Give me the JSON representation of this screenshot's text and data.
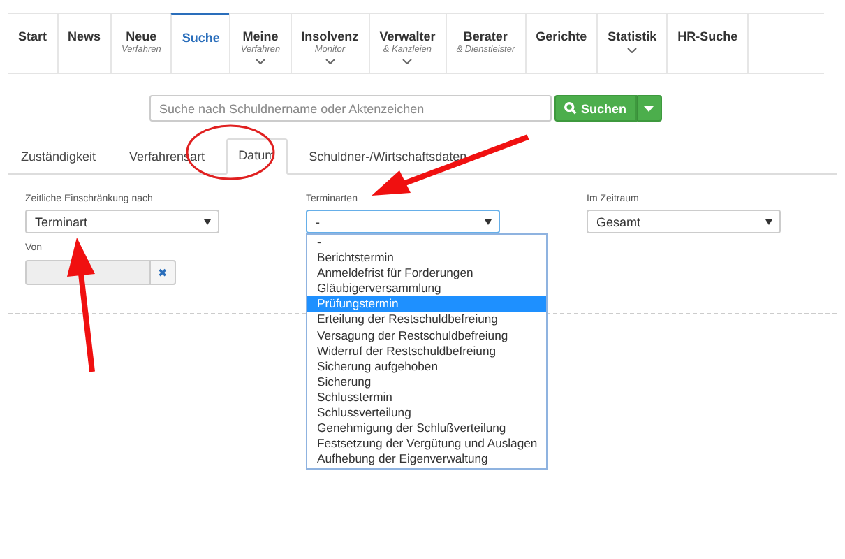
{
  "nav": [
    {
      "label": "Start",
      "caret": false,
      "selected": false
    },
    {
      "label": "News",
      "caret": false,
      "selected": false
    },
    {
      "label": "Neue",
      "sub": "Verfahren",
      "caret": false,
      "selected": false
    },
    {
      "label": "Suche",
      "caret": false,
      "selected": true
    },
    {
      "label": "Meine",
      "sub": "Verfahren",
      "caret": true,
      "selected": false
    },
    {
      "label": "Insolvenz",
      "sub": "Monitor",
      "caret": true,
      "selected": false
    },
    {
      "label": "Verwalter",
      "sub": "& Kanzleien",
      "caret": true,
      "selected": false
    },
    {
      "label": "Berater",
      "sub": "& Dienstleister",
      "caret": false,
      "selected": false
    },
    {
      "label": "Gerichte",
      "caret": false,
      "selected": false
    },
    {
      "label": "Statistik",
      "caret": true,
      "selected": false
    },
    {
      "label": "HR-Suche",
      "caret": false,
      "selected": false
    }
  ],
  "search": {
    "placeholder": "Suche nach Schuldnername oder Aktenzeichen",
    "button": "Suchen"
  },
  "tabs": [
    {
      "label": "Zuständigkeit",
      "selected": false
    },
    {
      "label": "Verfahrensart",
      "selected": false
    },
    {
      "label": "Datum",
      "selected": true
    },
    {
      "label": "Schuldner-/Wirtschaftsdaten",
      "selected": false
    }
  ],
  "filters": [
    {
      "label": "Zeitliche Einschränkung nach",
      "value": "Terminart",
      "focused": false
    },
    {
      "label": "Terminarten",
      "value": "-",
      "focused": true
    },
    {
      "label": "Im Zeitraum",
      "value": "Gesamt",
      "focused": false
    }
  ],
  "von": {
    "label": "Von",
    "clear": "✖"
  },
  "dropdown": [
    {
      "label": "-",
      "selected": false
    },
    {
      "label": "Berichtstermin",
      "selected": false
    },
    {
      "label": "Anmeldefrist für Forderungen",
      "selected": false
    },
    {
      "label": "Gläubigerversammlung",
      "selected": false
    },
    {
      "label": "Prüfungstermin",
      "selected": true
    },
    {
      "label": "Erteilung der Restschuldbefreiung",
      "selected": false
    },
    {
      "label": "Versagung der Restschuldbefreiung",
      "selected": false
    },
    {
      "label": "Widerruf der Restschuldbefreiung",
      "selected": false
    },
    {
      "label": "Sicherung aufgehoben",
      "selected": false
    },
    {
      "label": "Sicherung",
      "selected": false
    },
    {
      "label": "Schlusstermin",
      "selected": false
    },
    {
      "label": "Schlussverteilung",
      "selected": false
    },
    {
      "label": "Genehmigung der Schlußverteilung",
      "selected": false
    },
    {
      "label": "Festsetzung der Vergütung und Auslagen",
      "selected": false
    },
    {
      "label": "Aufhebung der Eigenverwaltung",
      "selected": false
    }
  ]
}
